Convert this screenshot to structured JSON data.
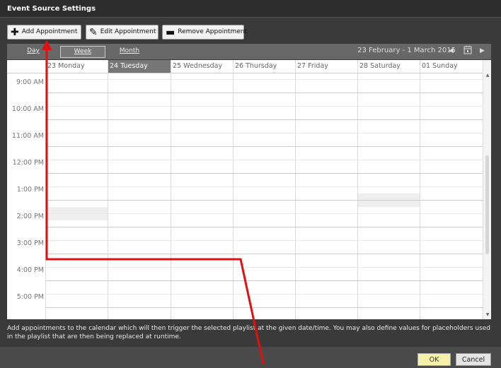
{
  "window": {
    "title": "Event Source Settings"
  },
  "toolbar": {
    "add_label": "Add Appointment",
    "edit_label": "Edit Appointment",
    "remove_label": "Remove Appointment"
  },
  "nav": {
    "views": [
      "Day",
      "Week",
      "Month"
    ],
    "active_view": "Week",
    "date_range": "23 February - 1 March 2015",
    "prev_glyph": "◀",
    "next_glyph": "▶",
    "calendar_icon": "calendar-icon"
  },
  "calendar": {
    "days": [
      "23 Monday",
      "24 Tuesday",
      "25 Wednesday",
      "26 Thursday",
      "27 Friday",
      "28 Saturday",
      "01 Sunday"
    ],
    "today_index": 1,
    "times": [
      "9:00 AM",
      "10:00 AM",
      "11:00 AM",
      "12:00 PM",
      "1:00 PM",
      "2:00 PM",
      "3:00 PM",
      "4:00 PM",
      "5:00 PM"
    ]
  },
  "info_text": "Add appointments to the calendar which will then trigger the selected playlist at the given date/time. You may also define values for placeholders used in the playlist that are then being replaced at runtime.",
  "footer": {
    "ok_label": "OK",
    "cancel_label": "Cancel"
  },
  "colors": {
    "annotation": "#e01010",
    "ok_button": "#f5f0a8",
    "today_header": "#777777"
  }
}
